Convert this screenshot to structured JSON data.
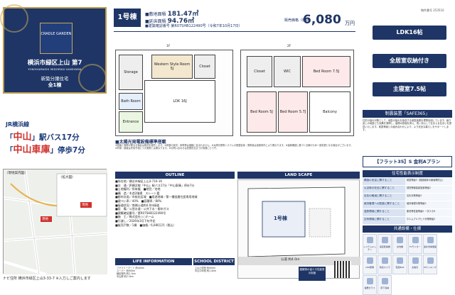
{
  "left": {
    "brand": "CRADLE GARDEN",
    "site_title": "横浜市緑区上山 第7",
    "site_sub": "YOKOHAMASHI MIDORIKU KAMIYAMA",
    "tag": "新築分譲住宅",
    "count": "全1棟",
    "line": "JR横浜線",
    "access1_station": "中山",
    "access1_rest": "駅バス17分",
    "access2_station": "中山車庫",
    "access2_rest": "停歩7分",
    "map_label_left": "〈現地案内図〉",
    "map_label_right": "〈拡大図〉",
    "map_site": "現地",
    "map_caption": "ナビ住所 横浜市緑区上山3-33-7 ※入力しご案内します"
  },
  "header": {
    "unit": "1号棟",
    "land_area_label": "敷地面積",
    "land_area": "181.47㎡",
    "floor_area_label": "延床面積",
    "floor_area": "94.76㎡",
    "confirm_label": "建築確認番号",
    "confirm_no": "第R07SHB122490号（令和7年10月17日）",
    "price_label": "販売価格（税込）",
    "price": "6,080",
    "price_unit": "万円",
    "photo_no": "物件番号 253510"
  },
  "plan": {
    "floor1": "1F",
    "floor2": "2F",
    "rooms1": [
      {
        "name": "Western Style Room 5J"
      },
      {
        "name": "LDK 16J"
      },
      {
        "name": "Bath Room"
      },
      {
        "name": "Closet"
      },
      {
        "name": "Entrance"
      },
      {
        "name": "Storage"
      }
    ],
    "rooms2": [
      {
        "name": "Bed Room 7.5J"
      },
      {
        "name": "Bed Room 5J"
      },
      {
        "name": "Bed Room 5.7J"
      },
      {
        "name": "Balcony"
      },
      {
        "name": "Closet"
      },
      {
        "name": "WIC"
      }
    ],
    "solar_title": "太陽光発電設備標準搭載",
    "notes": "※図面と実際が異なる場合は現況を優先します。※掲載の家具・家電等は価格に含まれません。※太陽光発電システムの搭載容量・発電量は設置条件により異なります。※建築確認に基づく仕様のため一部変更となる場合がございます。※外構・植栽は完成予想につき実際とは異なります。※お問い合わせは営業担当までお気軽にどうぞ。"
  },
  "features": [
    "LDK16帖",
    "全居室収納付き",
    "主寝室7.5帖"
  ],
  "safe": {
    "head": "制震装置「SAFE365」",
    "text": "住宅の揺れ対策として、地震の揺れを吸収する制震装置を標準採用しています。繰り返しの地震にも効果を発揮し、建物の損傷を抑え、長く安心して住まえる住まいを提供いたします。耐震等級との組み合わせにより、より安全な暮らしをサポートします。",
    "flat35": "【フラット35】S 金利Aプラン"
  },
  "performance": {
    "head": "住宅性能表示制度",
    "rows": [
      {
        "k": "構造の安定に関すること",
        "v": "耐震等級3（構造躯体の倒壊等防止）"
      },
      {
        "k": "火災時の安全に関すること",
        "v": "感知警報装置設置等級2"
      },
      {
        "k": "劣化の軽減に関すること",
        "v": "劣化対策等級3"
      },
      {
        "k": "維持管理への配慮に関すること",
        "v": "維持管理対策等級3"
      },
      {
        "k": "温熱環境に関すること",
        "v": "断熱等性能等級5 一次エネ6"
      },
      {
        "k": "空気環境に関すること",
        "v": "ホルムアルデヒド対策等級3"
      }
    ]
  },
  "equipment": {
    "head": "共通設備・仕様",
    "items": [
      "システムキッチン",
      "浴室乾燥機",
      "食洗機",
      "TVモニター",
      "温水洗浄便座",
      "LED照明",
      "防犯カメラ",
      "宅配BOX",
      "太陽光",
      "IHクッキング",
      "複層ガラス",
      "床下収納"
    ]
  },
  "outline": {
    "head": "OUTLINE",
    "rows": [
      "■所在地／横浜市緑区上山3-716-16",
      "■交　通／JR横浜線「中山」駅バス17分「中山車庫」停歩7分",
      "■土地権利／所有権　■地目／宅地",
      "■構　造／木造2階建　スレート葺",
      "■都市計画／市街化区域　■用途地域／第一種低層住居専用地域",
      "■建ぺい率／40%　■容積率／80%",
      "■接道状況／南側公道約4.0m接道",
      "■設　備／公営水道・公共下水・都市ガス",
      "■建築確認番号／第R07SHB122490号",
      "■施　工／株式会社○○ホーム",
      "■引渡し／2026年3月下旬予定",
      "■販売戸数／1棟　■価格／6,080万円（税込）"
    ]
  },
  "land": {
    "head": "LAND SCAPE",
    "unit": "1号棟",
    "road": "公道 約4.0m"
  },
  "life": {
    "head": "LIFE INFORMATION",
    "items": [
      "ファミリーマート 約400m",
      "スーパー 約900m",
      "緑区役所 約2.1km",
      "中山駅 約2.3km"
    ]
  },
  "school": {
    "head": "SCHOOL DISTRICT",
    "items": [
      "上山小学校 約900m",
      "中山中学校 約1.4km"
    ]
  },
  "eco": "建築物の省エネ性能表示制度"
}
